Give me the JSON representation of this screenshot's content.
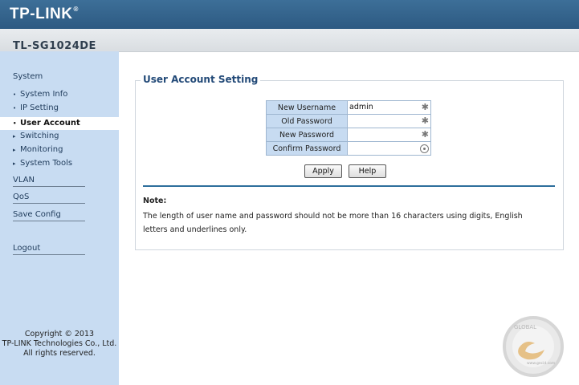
{
  "header": {
    "brand": "TP-LINK",
    "trademark": "®",
    "model": "TL-SG1024DE"
  },
  "sidebar": {
    "top_label": "System",
    "items": [
      {
        "label": "System Info",
        "bullet": "•"
      },
      {
        "label": "IP Setting",
        "bullet": "•"
      },
      {
        "label": "User Account",
        "bullet": "•"
      },
      {
        "label": "Switching",
        "bullet": "▸"
      },
      {
        "label": "Monitoring",
        "bullet": "▸"
      },
      {
        "label": "System Tools",
        "bullet": "▸"
      }
    ],
    "sections": [
      "VLAN",
      "QoS",
      "Save Config",
      "Logout"
    ],
    "copyright": [
      "Copyright © 2013",
      "TP-LINK Technologies Co., Ltd.",
      "All rights reserved."
    ]
  },
  "main": {
    "title": "User Account Setting",
    "fields": [
      {
        "label": "New Username",
        "value": "admin"
      },
      {
        "label": "Old Password",
        "value": ""
      },
      {
        "label": "New Password",
        "value": ""
      },
      {
        "label": "Confirm Password",
        "value": ""
      }
    ],
    "buttons": {
      "apply": "Apply",
      "help": "Help"
    },
    "note_title": "Note:",
    "note_text": "The length of user name and password should not be more than 16 characters using digits, English letters and underlines only."
  },
  "icons": {
    "required": "asterisk-icon",
    "confirm": "eye-icon"
  },
  "colors": {
    "header": "#2d5a82",
    "sidebar": "#c8dcf2",
    "title": "#234a78",
    "rule": "#2d6e9c"
  },
  "watermark": {
    "text": "GLOBAL",
    "site": "www.gecid.com"
  }
}
